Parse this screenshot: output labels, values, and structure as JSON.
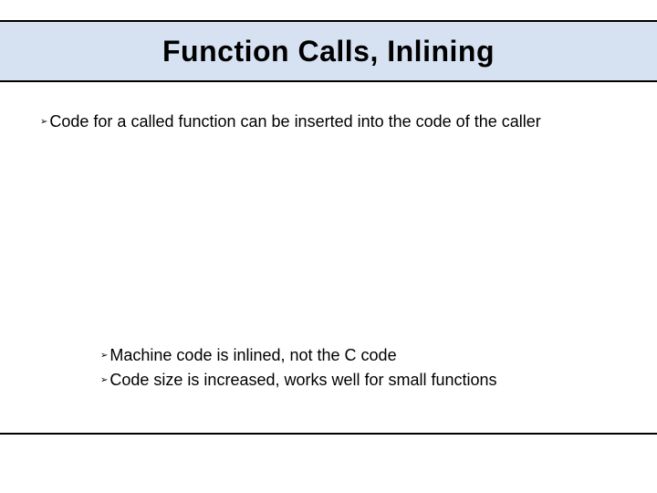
{
  "title": "Function Calls, Inlining",
  "bullets": {
    "top": "Code for a called function can be inserted into the code of the caller",
    "sub": [
      "Machine code is inlined, not the C code",
      "Code size is increased, works well for small functions"
    ]
  },
  "glyphs": {
    "chevron": "➢"
  }
}
